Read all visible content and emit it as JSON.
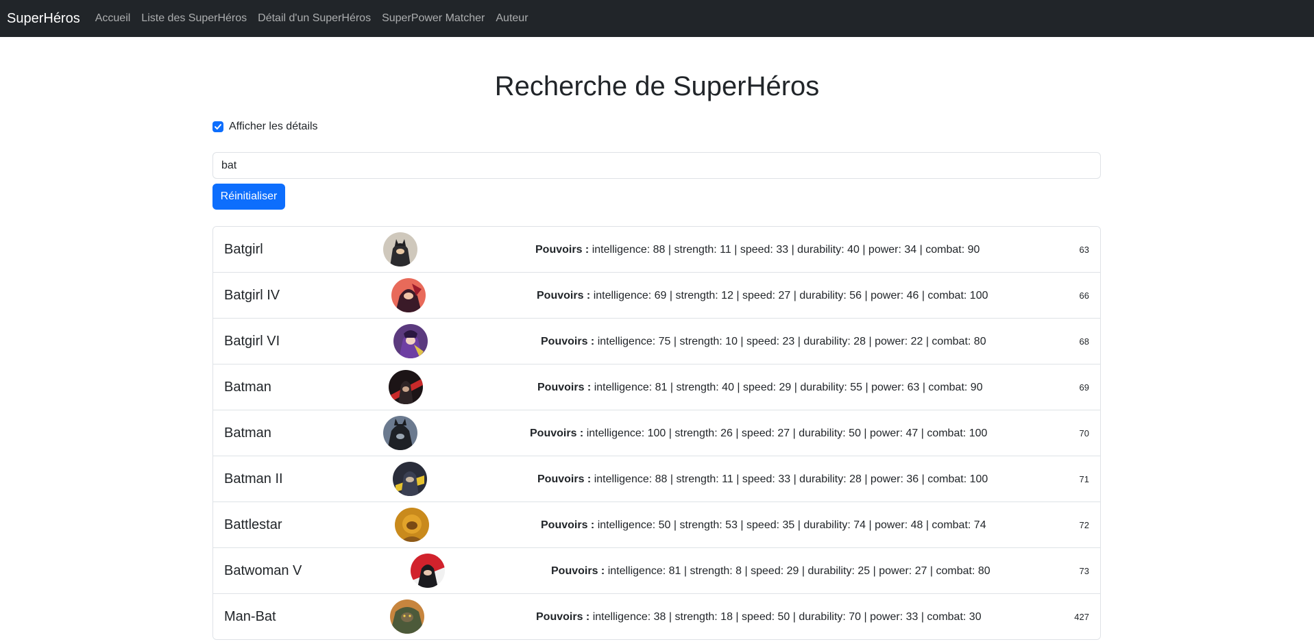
{
  "nav": {
    "brand": "SuperHéros",
    "links": [
      "Accueil",
      "Liste des SuperHéros",
      "Détail d'un SuperHéros",
      "SuperPower Matcher",
      "Auteur"
    ]
  },
  "page_title": "Recherche de SuperHéros",
  "details_checkbox": {
    "label": "Afficher les détails",
    "checked": true
  },
  "search": {
    "value": "bat"
  },
  "reset_button": "Réinitialiser",
  "powers_label": "Pouvoirs :",
  "colors": {
    "accent": "#0d6efd",
    "navbar": "#212529"
  },
  "heroes": [
    {
      "name": "Batgirl",
      "powers": "intelligence: 88 | strength: 11 | speed: 33 | durability: 40 | power: 34 | combat: 90",
      "id": "63"
    },
    {
      "name": "Batgirl IV",
      "powers": "intelligence: 69 | strength: 12 | speed: 27 | durability: 56 | power: 46 | combat: 100",
      "id": "66"
    },
    {
      "name": "Batgirl VI",
      "powers": "intelligence: 75 | strength: 10 | speed: 23 | durability: 28 | power: 22 | combat: 80",
      "id": "68"
    },
    {
      "name": "Batman",
      "powers": "intelligence: 81 | strength: 40 | speed: 29 | durability: 55 | power: 63 | combat: 90",
      "id": "69"
    },
    {
      "name": "Batman",
      "powers": "intelligence: 100 | strength: 26 | speed: 27 | durability: 50 | power: 47 | combat: 100",
      "id": "70"
    },
    {
      "name": "Batman II",
      "powers": "intelligence: 88 | strength: 11 | speed: 33 | durability: 28 | power: 36 | combat: 100",
      "id": "71"
    },
    {
      "name": "Battlestar",
      "powers": "intelligence: 50 | strength: 53 | speed: 35 | durability: 74 | power: 48 | combat: 74",
      "id": "72"
    },
    {
      "name": "Batwoman V",
      "powers": "intelligence: 81 | strength: 8 | speed: 29 | durability: 25 | power: 27 | combat: 80",
      "id": "73"
    },
    {
      "name": "Man-Bat",
      "powers": "intelligence: 38 | strength: 18 | speed: 50 | durability: 70 | power: 33 | combat: 30",
      "id": "427"
    }
  ]
}
